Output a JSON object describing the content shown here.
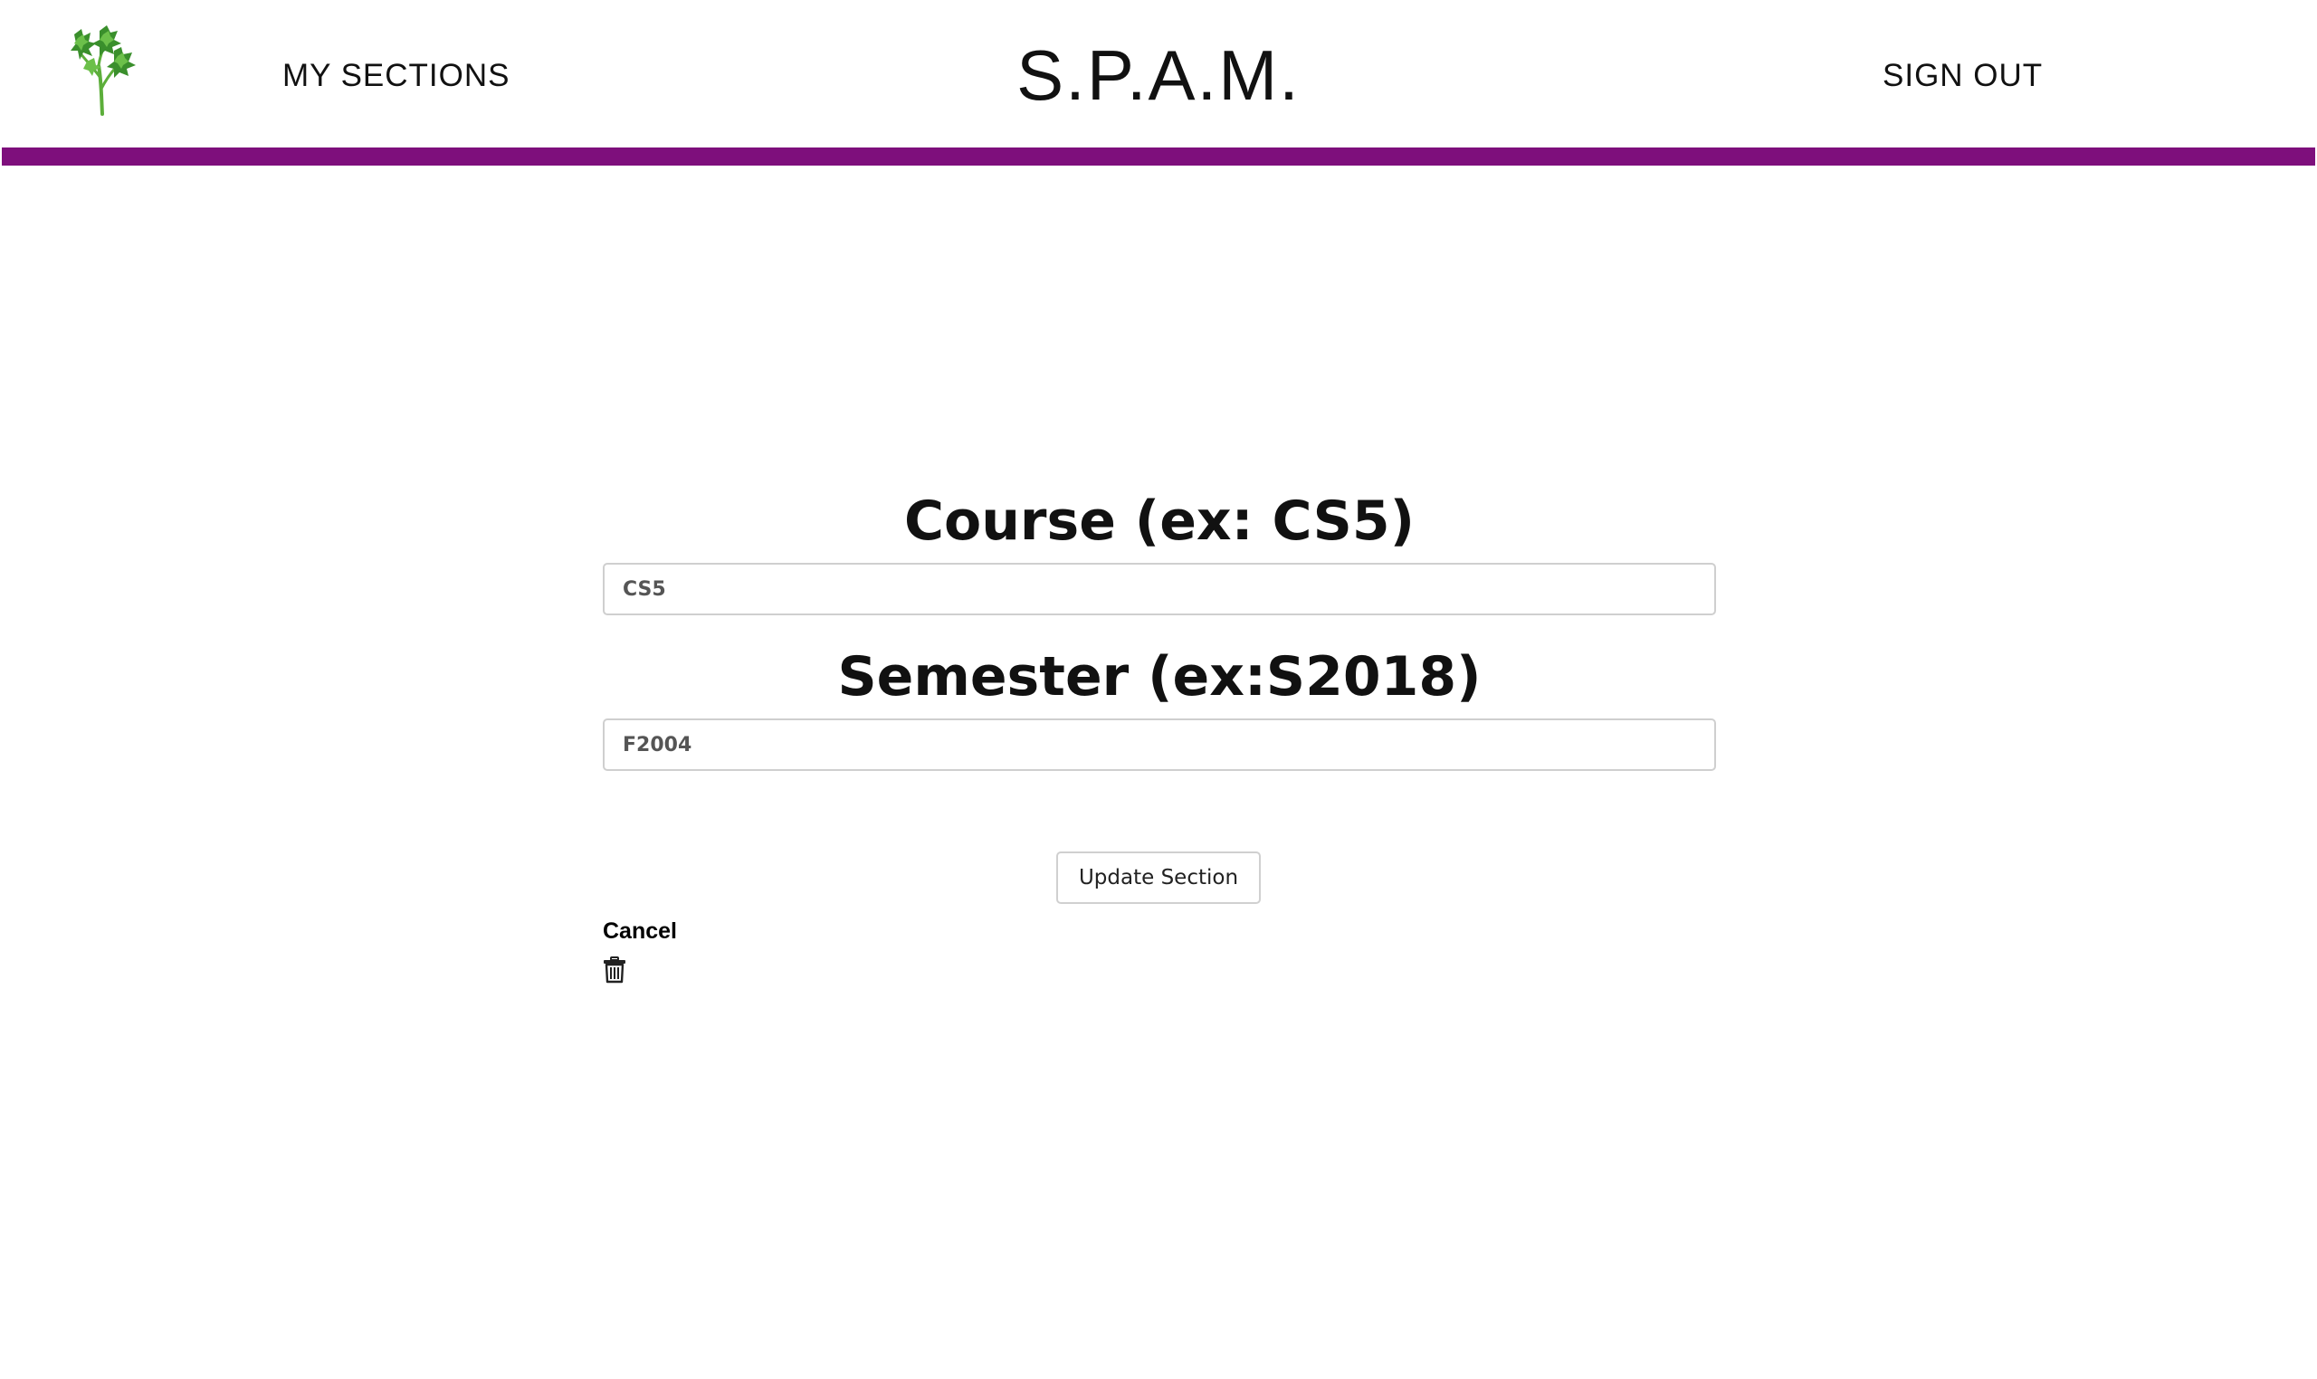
{
  "header": {
    "logo_icon": "cilantro-icon",
    "my_sections_label": "MY SECTIONS",
    "title": "S.P.A.M.",
    "sign_out_label": "SIGN OUT",
    "accent_color": "#7e0f7c"
  },
  "form": {
    "course": {
      "label": "Course (ex: CS5)",
      "value": "CS5"
    },
    "semester": {
      "label": "Semester (ex:S2018)",
      "value": "F2004"
    },
    "update_label": "Update Section",
    "cancel_label": "Cancel",
    "delete_icon": "trash-icon"
  }
}
